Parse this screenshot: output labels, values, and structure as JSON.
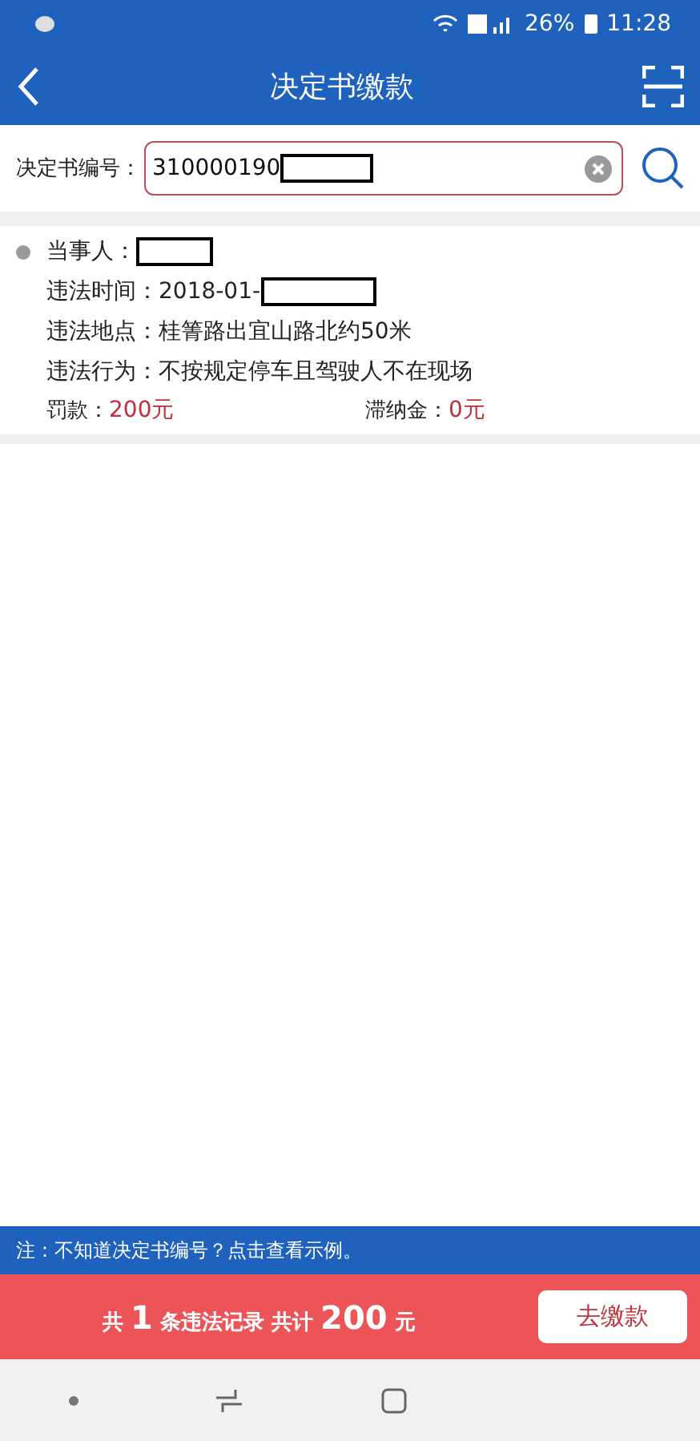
{
  "status_bar": {
    "battery": "26%",
    "time": "11:28"
  },
  "header": {
    "title": "决定书缴款"
  },
  "search": {
    "label": "决定书编号：",
    "value": "310000190",
    "redacted": true
  },
  "record": {
    "fields": [
      {
        "label": "当事人：",
        "redacted": true
      },
      {
        "label": "违法时间：",
        "value": "2018-01-",
        "redacted": true
      },
      {
        "label": "违法地点：",
        "value": "桂箐路出宜山路北约50米",
        "redacted": false
      },
      {
        "label": "违法行为：",
        "value": "不按规定停车且驾驶人不在现场",
        "redacted": false
      }
    ],
    "fine": {
      "label": "罚款：",
      "value": "200元"
    },
    "late_fee": {
      "label": "滞纳金：",
      "value": "0元"
    }
  },
  "note": "注：不知道决定书编号？点击查看示例。",
  "summary": {
    "prefix": "共",
    "count": "1",
    "middle": "条违法记录  共计",
    "total": "200",
    "suffix": "元",
    "button": "去缴款"
  }
}
